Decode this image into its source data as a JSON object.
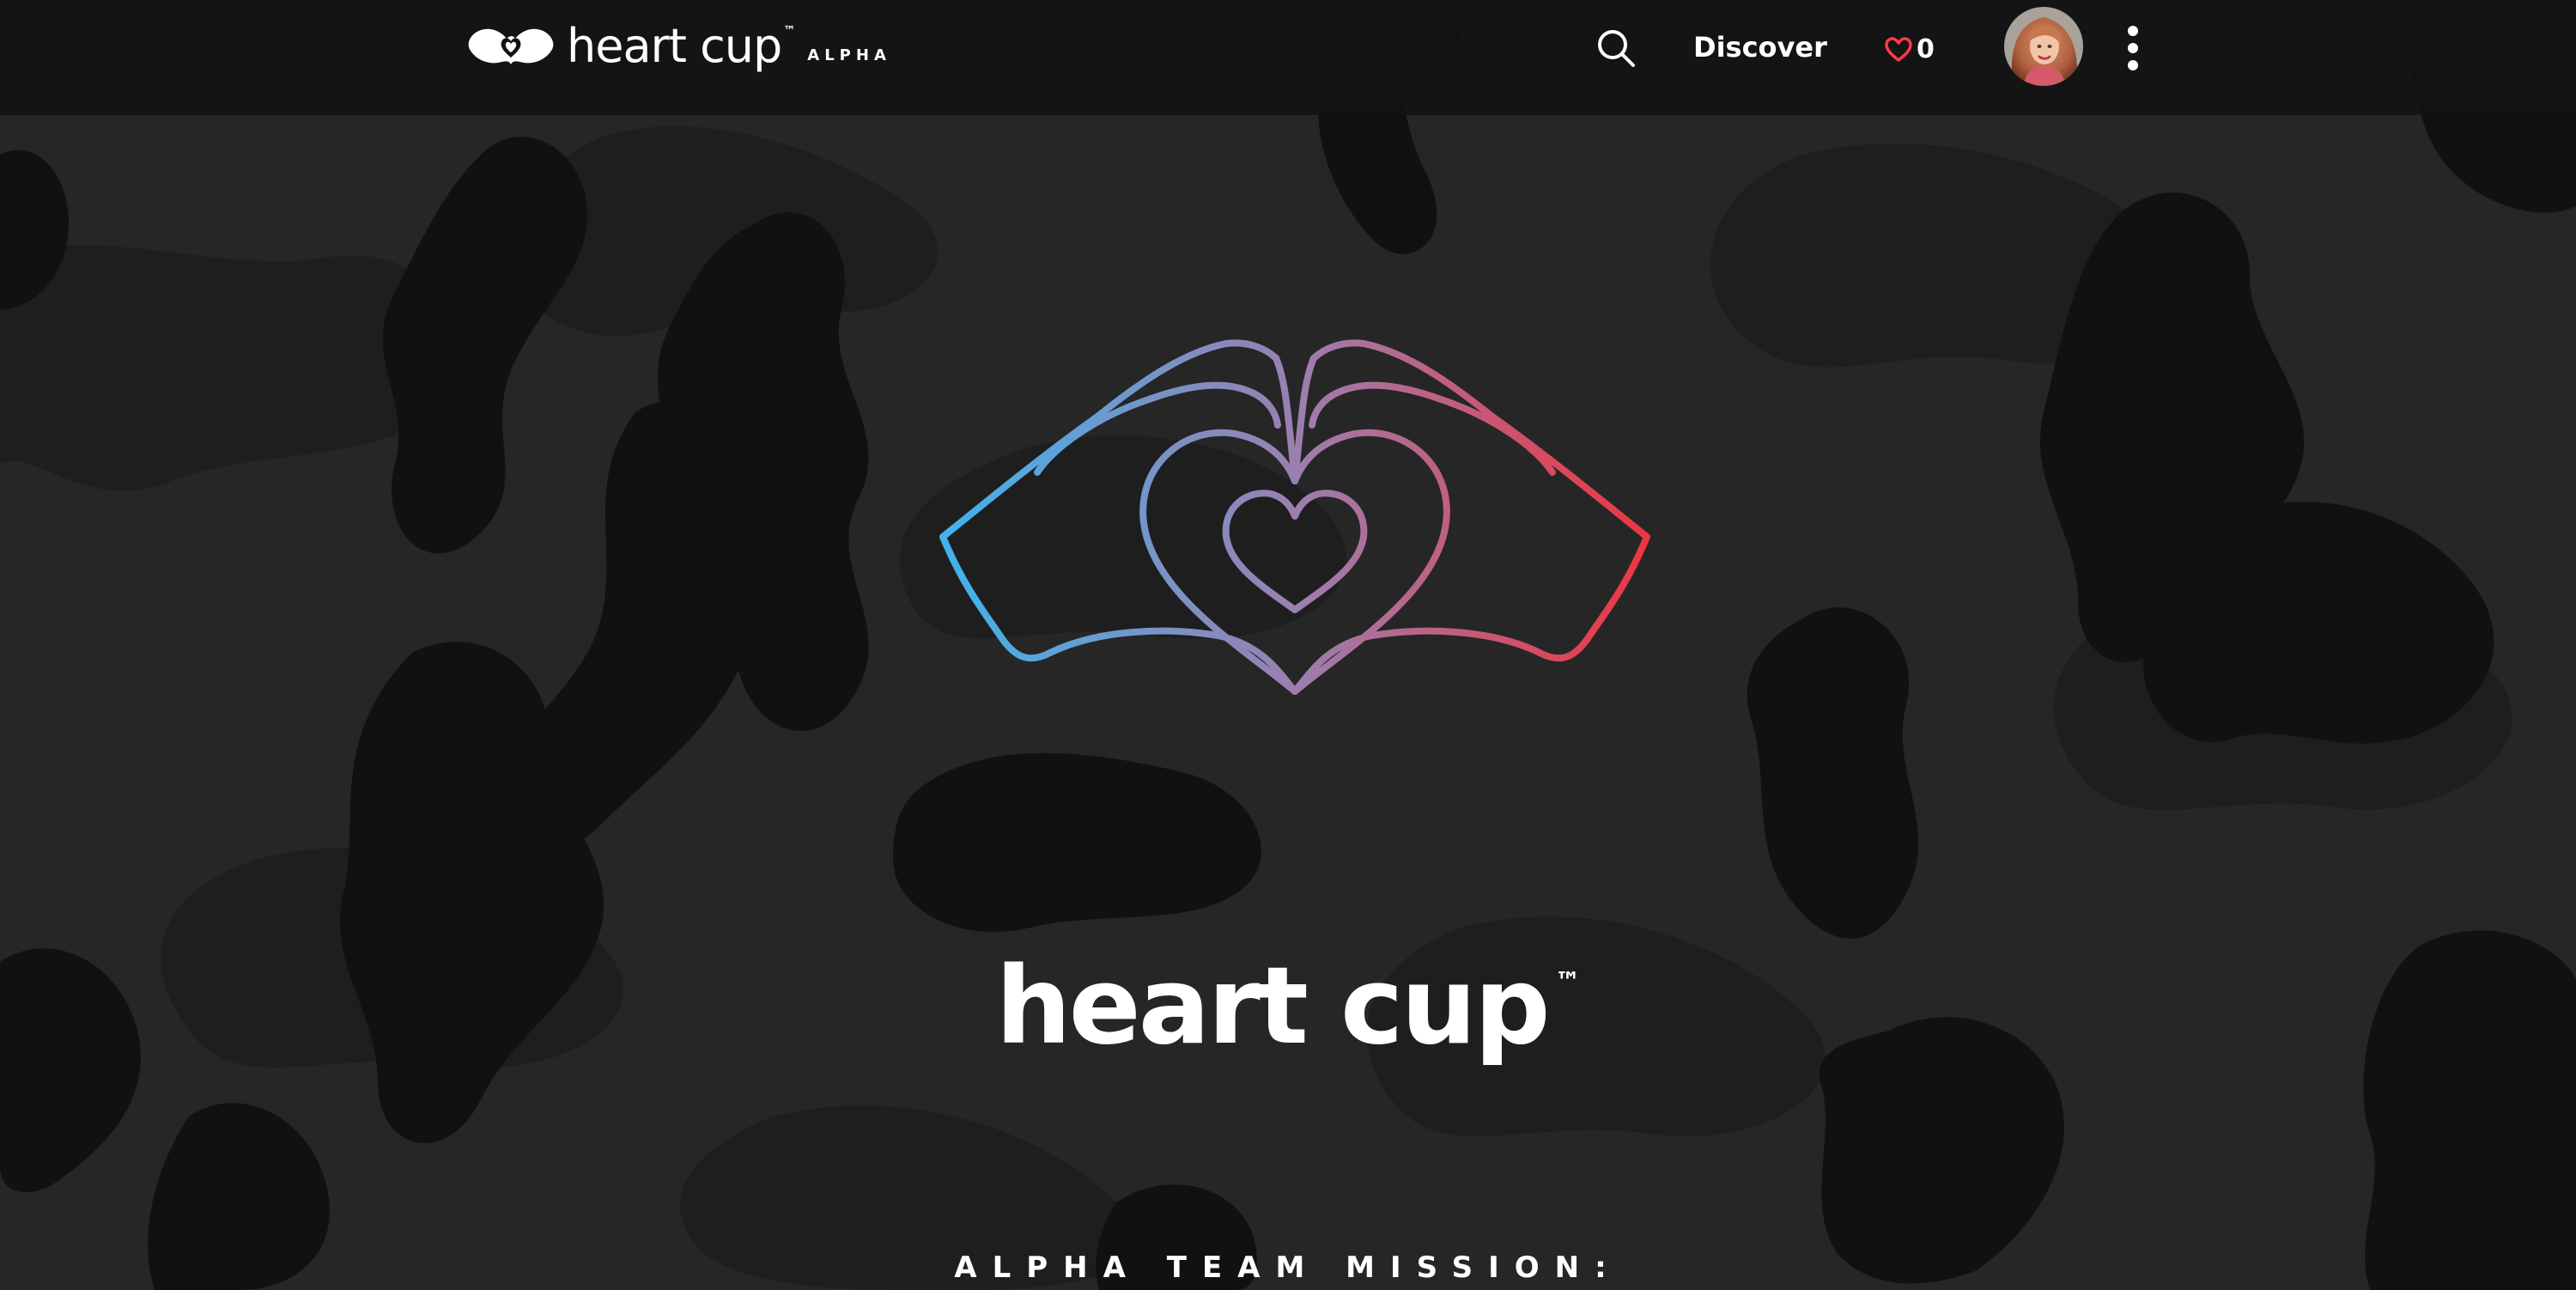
{
  "brand": {
    "name": "heart cup",
    "tm": "™",
    "stage": "ALPHA"
  },
  "nav": {
    "search_icon": "search-icon",
    "discover_label": "Discover",
    "likes_icon": "heart-outline-icon",
    "likes_count": "0",
    "menu_icon": "vertical-ellipsis-icon"
  },
  "hero": {
    "title": "heart cup",
    "tm": "™",
    "logo_icon": "hands-heart-icon"
  },
  "mission": {
    "heading": "ALPHA TEAM MISSION:"
  },
  "colors": {
    "navbar": "#121212",
    "background": "#262627",
    "camo_dark": "#141414",
    "camo_mid": "#1c1c1c",
    "gradient_left": "#3fb4ec",
    "gradient_mid": "#9b7fb0",
    "gradient_right": "#f0343e",
    "like_red": "#ff3b4a"
  }
}
